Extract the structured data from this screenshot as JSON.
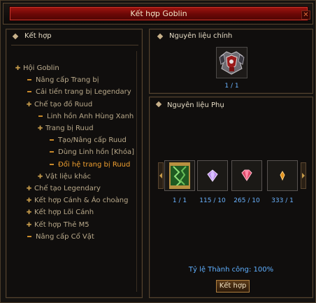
{
  "window": {
    "title": "Kết hợp Goblin"
  },
  "left_panel": {
    "header": "Kết hợp",
    "tree": [
      {
        "label": "Hội Goblin",
        "level": 0,
        "marker": "bullet",
        "active": false
      },
      {
        "label": "Nâng cấp Trang bị",
        "level": 1,
        "marker": "dash",
        "active": false
      },
      {
        "label": "Cải tiến trang bị Legendary",
        "level": 1,
        "marker": "dash",
        "active": false
      },
      {
        "label": "Chế tạo đồ Ruud",
        "level": 1,
        "marker": "bullet",
        "active": false
      },
      {
        "label": "Linh hồn Anh Hùng Xanh",
        "level": 2,
        "marker": "dash",
        "active": false
      },
      {
        "label": "Trang bị Ruud",
        "level": 2,
        "marker": "bullet",
        "active": false
      },
      {
        "label": "Tạo/Nâng cấp Ruud",
        "level": 3,
        "marker": "dash",
        "active": false
      },
      {
        "label": "Dùng Linh hồn [Khóa]",
        "level": 3,
        "marker": "dash",
        "active": false
      },
      {
        "label": "Đổi hệ trang bị Ruud",
        "level": 3,
        "marker": "dash",
        "active": true
      },
      {
        "label": "Vật liệu khác",
        "level": 2,
        "marker": "bullet",
        "active": false
      },
      {
        "label": "Chế tạo Legendary",
        "level": 1,
        "marker": "bullet",
        "active": false
      },
      {
        "label": "Kết hợp Cánh & Áo choàng",
        "level": 1,
        "marker": "bullet",
        "active": false
      },
      {
        "label": "Kết hợp Lõi Cánh",
        "level": 1,
        "marker": "bullet",
        "active": false
      },
      {
        "label": "Kết hợp Thẻ M5",
        "level": 1,
        "marker": "bullet",
        "active": false
      },
      {
        "label": "Nâng cấp Cổ Vật",
        "level": 1,
        "marker": "dash",
        "active": false
      }
    ]
  },
  "main_material": {
    "header": "Nguyên liệu chính",
    "count": "1 / 1",
    "icon": "ruud-armor-icon"
  },
  "sub_materials": {
    "header": "Nguyên liệu Phụ",
    "items": [
      {
        "icon": "green-scroll-icon",
        "count": "1 / 1"
      },
      {
        "icon": "purple-gem-icon",
        "count": "115 / 10"
      },
      {
        "icon": "red-gem-icon",
        "count": "265 / 10"
      },
      {
        "icon": "orange-crystal-icon",
        "count": "333 / 1"
      }
    ]
  },
  "success_rate": "Tỷ lệ Thành công: 100%",
  "combine_button": "Kết hợp",
  "colors": {
    "accent_blue": "#5fb0ff",
    "active_orange": "#f0a030",
    "title_red": "#8a0c08"
  }
}
